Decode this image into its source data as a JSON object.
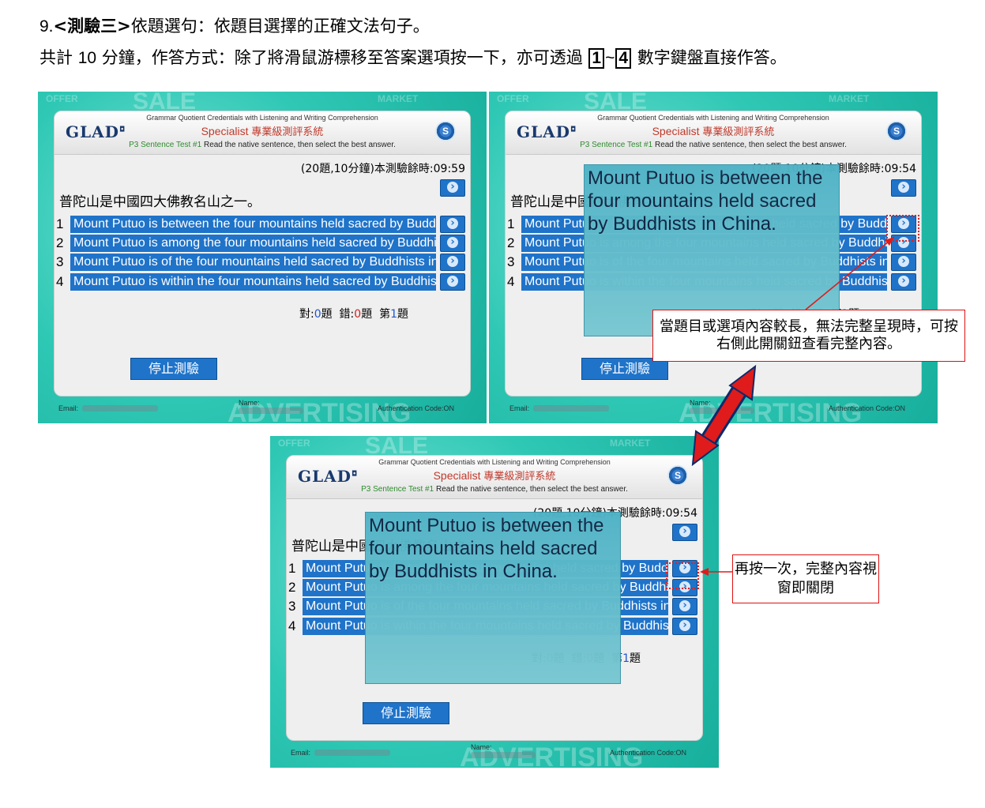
{
  "heading": {
    "number": "9.",
    "test": "<測驗三>",
    "rest": "依題選句：依題目選擇的正確文法句子。"
  },
  "intro": {
    "part1": "共計 ",
    "minutes": "10",
    "part2": " 分鐘，作答方式：除了將滑鼠游標移至答案選項按一下，亦可透過 ",
    "key1": "1",
    "tilde": "~",
    "key2": "4",
    "part3": " 數字鍵盤直接作答。"
  },
  "app": {
    "header_top": "Grammar Quotient Credentials with Listening and Writing Comprehension",
    "header_title_en": "Specialist ",
    "header_title_zh": "專業級測評系統",
    "header_test": "P3 Sentence Test #1",
    "header_instruction": " Read the native sentence, then select the best answer.",
    "logo": "GLAD",
    "s_logo": "S",
    "timer_panel1": "(20題,10分鐘)本測驗餘時:09:59",
    "timer_panel2": "(20題,10分鐘)本測驗餘時:09:54",
    "question": "普陀山是中國四大佛教名山之一。",
    "options": [
      {
        "num": "1",
        "text": "Mount Putuo is between the four mountains held sacred by Buddhists in China."
      },
      {
        "num": "2",
        "text": "Mount Putuo is among the four mountains held sacred by Buddhists in China."
      },
      {
        "num": "3",
        "text": "Mount Putuo is of the four mountains held sacred by Buddhists in China."
      },
      {
        "num": "4",
        "text": "Mount Putuo is within the four mountains held sacred by Buddhists in China."
      }
    ],
    "score": {
      "correct_label": "對:",
      "correct": "0",
      "unit1": "題",
      "wrong_label": "錯:",
      "wrong": "0",
      "unit2": "題",
      "index_label": "第",
      "index": "1",
      "unit3": "題"
    },
    "stop_button": "停止測驗",
    "email_label": "Email:",
    "name_label": "Name:",
    "auth": "Authentication Code:ON",
    "popup_text": "Mount Putuo is between the four mountains held sacred by Buddhists in China."
  },
  "callout1": "當題目或選項內容較長，無法完整呈現時，可按右側此開關鈕查看完整內容。",
  "callout2": "再按一次，完整內容視窗即關閉",
  "colors": {
    "accent": "#1f73c9",
    "arrow": "#e01b1b",
    "teal": "#2fc8b5"
  }
}
